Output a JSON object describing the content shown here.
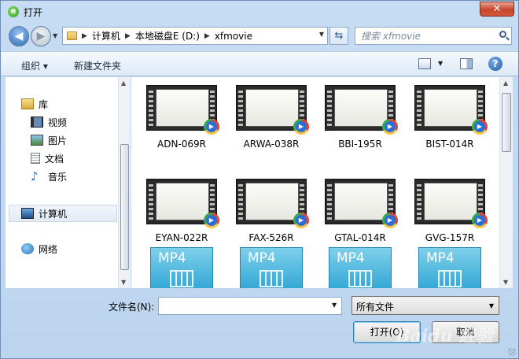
{
  "window": {
    "title": "打开",
    "close_label": "✕"
  },
  "nav": {
    "back_label": "◀",
    "forward_label": "▶",
    "breadcrumbs": [
      "计算机",
      "本地磁盘E (D:)",
      "xfmovie"
    ],
    "search_placeholder": "搜索 xfmovie"
  },
  "toolbar": {
    "organize_label": "组织 ▾",
    "new_folder_label": "新建文件夹",
    "help_label": "?"
  },
  "sidebar": {
    "items": [
      {
        "label": "库",
        "icon": "library-icon"
      },
      {
        "label": "视频",
        "icon": "video-icon"
      },
      {
        "label": "图片",
        "icon": "picture-icon"
      },
      {
        "label": "文档",
        "icon": "document-icon"
      },
      {
        "label": "音乐",
        "icon": "music-icon"
      },
      {
        "label": "计算机",
        "icon": "computer-icon"
      },
      {
        "label": "网络",
        "icon": "network-icon"
      }
    ]
  },
  "files": [
    {
      "name": "ADN-069R",
      "type": "video"
    },
    {
      "name": "ARWA-038R",
      "type": "video"
    },
    {
      "name": "BBI-195R",
      "type": "video"
    },
    {
      "name": "BIST-014R",
      "type": "video"
    },
    {
      "name": "EYAN-022R",
      "type": "video"
    },
    {
      "name": "FAX-526R",
      "type": "video"
    },
    {
      "name": "GTAL-014R",
      "type": "video"
    },
    {
      "name": "GVG-157R",
      "type": "video"
    },
    {
      "name": "MP4",
      "type": "mp4"
    },
    {
      "name": "MP4",
      "type": "mp4"
    },
    {
      "name": "MP4",
      "type": "mp4"
    },
    {
      "name": "MP4",
      "type": "mp4"
    }
  ],
  "bottom": {
    "filename_label": "文件名(N):",
    "filename_value": "",
    "filetype_value": "所有文件",
    "open_label": "打开(O)",
    "cancel_label": "取消"
  },
  "watermark": "Baidu 经验"
}
